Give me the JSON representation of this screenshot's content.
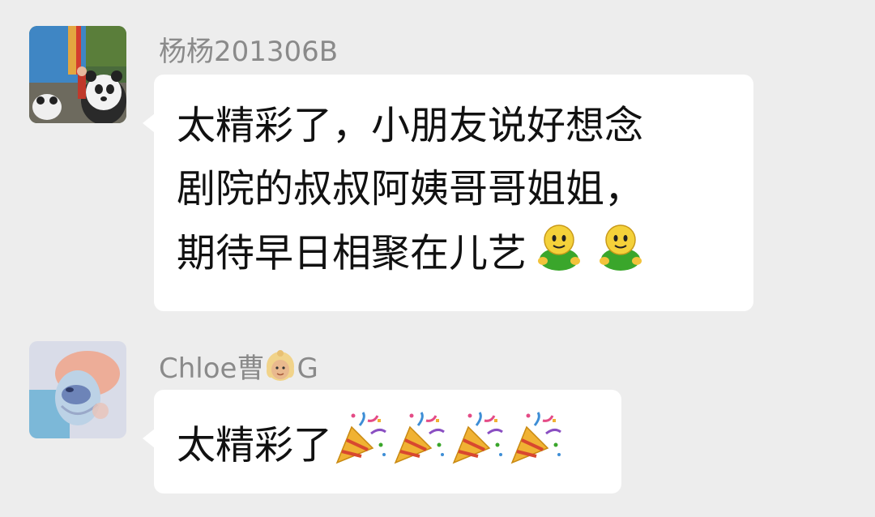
{
  "messages": [
    {
      "sender": "杨杨201306B",
      "avatar": "panda-photo-avatar",
      "lines": [
        "太精彩了，小朋友说好想念",
        "剧院的叔叔阿姨哥哥姐姐，",
        "期待早日相聚在儿艺"
      ],
      "trailing_emoji": [
        "green-smiley-icon",
        "green-smiley-icon"
      ]
    },
    {
      "sender_prefix": "Chloe曹",
      "sender_emoji": "girl-face-icon",
      "sender_suffix": "G",
      "avatar": "painted-face-avatar",
      "text": "太精彩了",
      "trailing_emoji": [
        "party-popper-icon",
        "party-popper-icon",
        "party-popper-icon",
        "party-popper-icon"
      ]
    }
  ],
  "colors": {
    "background": "#ededed",
    "bubble": "#ffffff",
    "sender_name": "#8a8a8a",
    "text": "#111111"
  }
}
